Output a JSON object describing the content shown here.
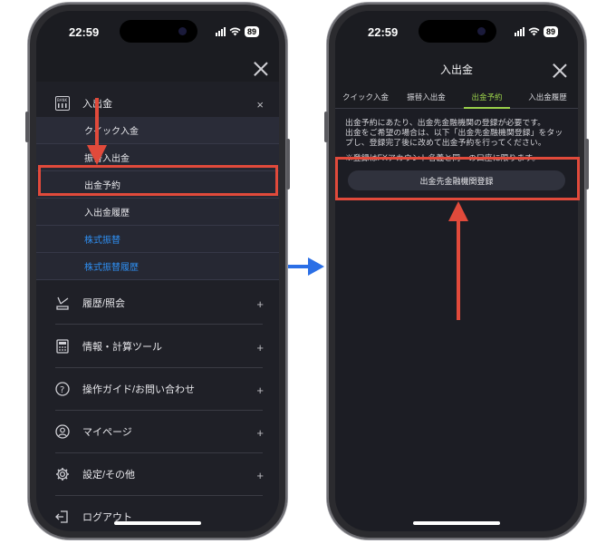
{
  "left_phone": {
    "status": {
      "time": "22:59",
      "battery": "89"
    },
    "menu": {
      "section_deposit": {
        "label": "入出金",
        "icon": "bank-icon",
        "items": [
          {
            "label": "クイック入金",
            "blue": false
          },
          {
            "label": "振替入出金",
            "blue": false
          },
          {
            "label": "出金予約",
            "blue": false
          },
          {
            "label": "入出金履歴",
            "blue": false
          },
          {
            "label": "株式振替",
            "blue": true
          },
          {
            "label": "株式振替履歴",
            "blue": true
          }
        ]
      },
      "sections": [
        {
          "label": "履歴/照会",
          "icon": "history-icon"
        },
        {
          "label": "情報・計算ツール",
          "icon": "calculator-icon"
        },
        {
          "label": "操作ガイド/お問い合わせ",
          "icon": "help-icon"
        },
        {
          "label": "マイページ",
          "icon": "user-icon"
        },
        {
          "label": "設定/その他",
          "icon": "gear-icon"
        },
        {
          "label": "ログアウト",
          "icon": "logout-icon"
        }
      ]
    }
  },
  "right_phone": {
    "status": {
      "time": "22:59",
      "battery": "89"
    },
    "title": "入出金",
    "tabs": [
      "クイック入金",
      "振替入出金",
      "出金予約",
      "入出金履歴"
    ],
    "active_tab": "出金予約",
    "notice_lines": [
      "出金予約にあたり、出金先金融機関の登録が必要です。",
      "出金をご希望の場合は、以下「出金先金融機関登録」をタップし、登録完了後に改めて出金予約を行ってください。",
      "※登録はFXアカウント名義と同一の口座に限ります。"
    ],
    "register_button": "出金先金融機関登録"
  },
  "colors": {
    "highlight": "#e14a3b",
    "connector_arrow": "#2b6fe6",
    "active_tab": "#9ad14a",
    "link_blue": "#2f8ef0"
  }
}
